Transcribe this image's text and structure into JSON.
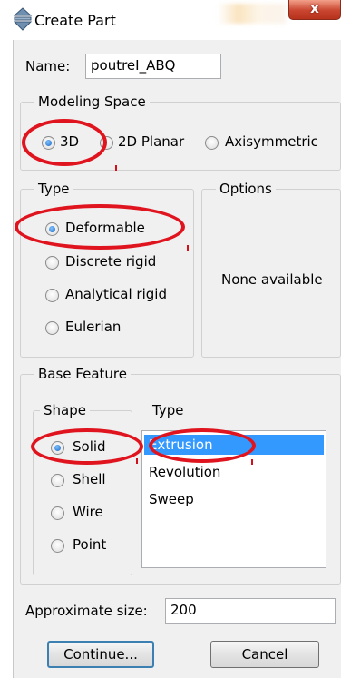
{
  "window": {
    "title": "Create Part",
    "close_label": "x"
  },
  "name": {
    "label": "Name:",
    "value": "poutreI_ABQ"
  },
  "modeling_space": {
    "title": "Modeling Space",
    "options": [
      "3D",
      "2D Planar",
      "Axisymmetric"
    ],
    "selected": "3D"
  },
  "type": {
    "title": "Type",
    "options": [
      "Deformable",
      "Discrete rigid",
      "Analytical rigid",
      "Eulerian"
    ],
    "selected": "Deformable"
  },
  "options_panel": {
    "title": "Options",
    "message": "None available"
  },
  "base_feature": {
    "title": "Base Feature",
    "shape": {
      "title": "Shape",
      "options": [
        "Solid",
        "Shell",
        "Wire",
        "Point"
      ],
      "selected": "Solid"
    },
    "feature_type": {
      "title": "Type",
      "items": [
        "Extrusion",
        "Revolution",
        "Sweep"
      ],
      "selected": "Extrusion"
    }
  },
  "approx_size": {
    "label": "Approximate size:",
    "value": "200"
  },
  "buttons": {
    "continue": "Continue...",
    "cancel": "Cancel"
  },
  "annotation_color": "#e0141e",
  "selection_color": "#3399ff"
}
